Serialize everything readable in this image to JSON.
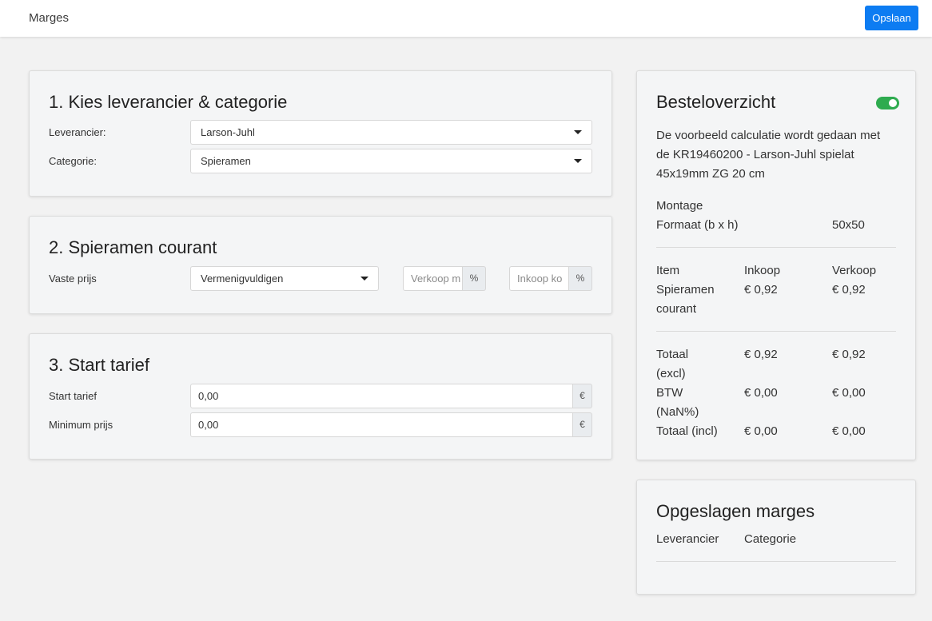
{
  "header": {
    "title": "Marges",
    "save_label": "Opslaan"
  },
  "section1": {
    "title": "1. Kies leverancier & categorie",
    "supplier_label": "Leverancier:",
    "supplier_value": "Larson-Juhl",
    "category_label": "Categorie:",
    "category_value": "Spieramen"
  },
  "section2": {
    "title": "2. Spieramen courant",
    "fixed_price_label": "Vaste prijs",
    "method_value": "Vermenigvuldigen",
    "sale_placeholder": "Verkoop m",
    "sale_unit": "%",
    "purchase_placeholder": "Inkoop ko",
    "purchase_unit": "%"
  },
  "section3": {
    "title": "3. Start tarief",
    "start_label": "Start tarief",
    "start_value": "0,00",
    "start_unit": "€",
    "min_label": "Minimum prijs",
    "min_value": "0,00",
    "min_unit": "€"
  },
  "overview": {
    "title": "Besteloverzicht",
    "toggle_on": true,
    "toggle_color": "#2eab4f",
    "desc_line1": "De voorbeeld calculatie wordt gedaan met",
    "desc_line2": "de KR19460200 - Larson-Juhl spielat",
    "desc_line3": "45x19mm ZG 20 cm",
    "montage": "Montage",
    "format_label": "Formaat (b x h)",
    "format_value": "50x50",
    "col_item": "Item",
    "col_purchase": "Inkoop",
    "col_sale": "Verkoop",
    "row_item_line1": "Spieramen",
    "row_item_line2": "courant",
    "row_purchase": "€ 0,92",
    "row_sale": "€ 0,92",
    "total_excl_line1": "Totaal",
    "total_excl_line2": "(excl)",
    "total_excl_purchase": "€ 0,92",
    "total_excl_sale": "€ 0,92",
    "btw_line1": "BTW",
    "btw_line2": "(NaN%)",
    "btw_purchase": "€ 0,00",
    "btw_sale": "€ 0,00",
    "total_incl": "Totaal (incl)",
    "total_incl_purchase": "€ 0,00",
    "total_incl_sale": "€ 0,00"
  },
  "saved": {
    "title": "Opgeslagen marges",
    "col_supplier": "Leverancier",
    "col_category": "Categorie"
  },
  "colors": {
    "primary": "#0d7cf2",
    "background": "#f2f2f2"
  }
}
